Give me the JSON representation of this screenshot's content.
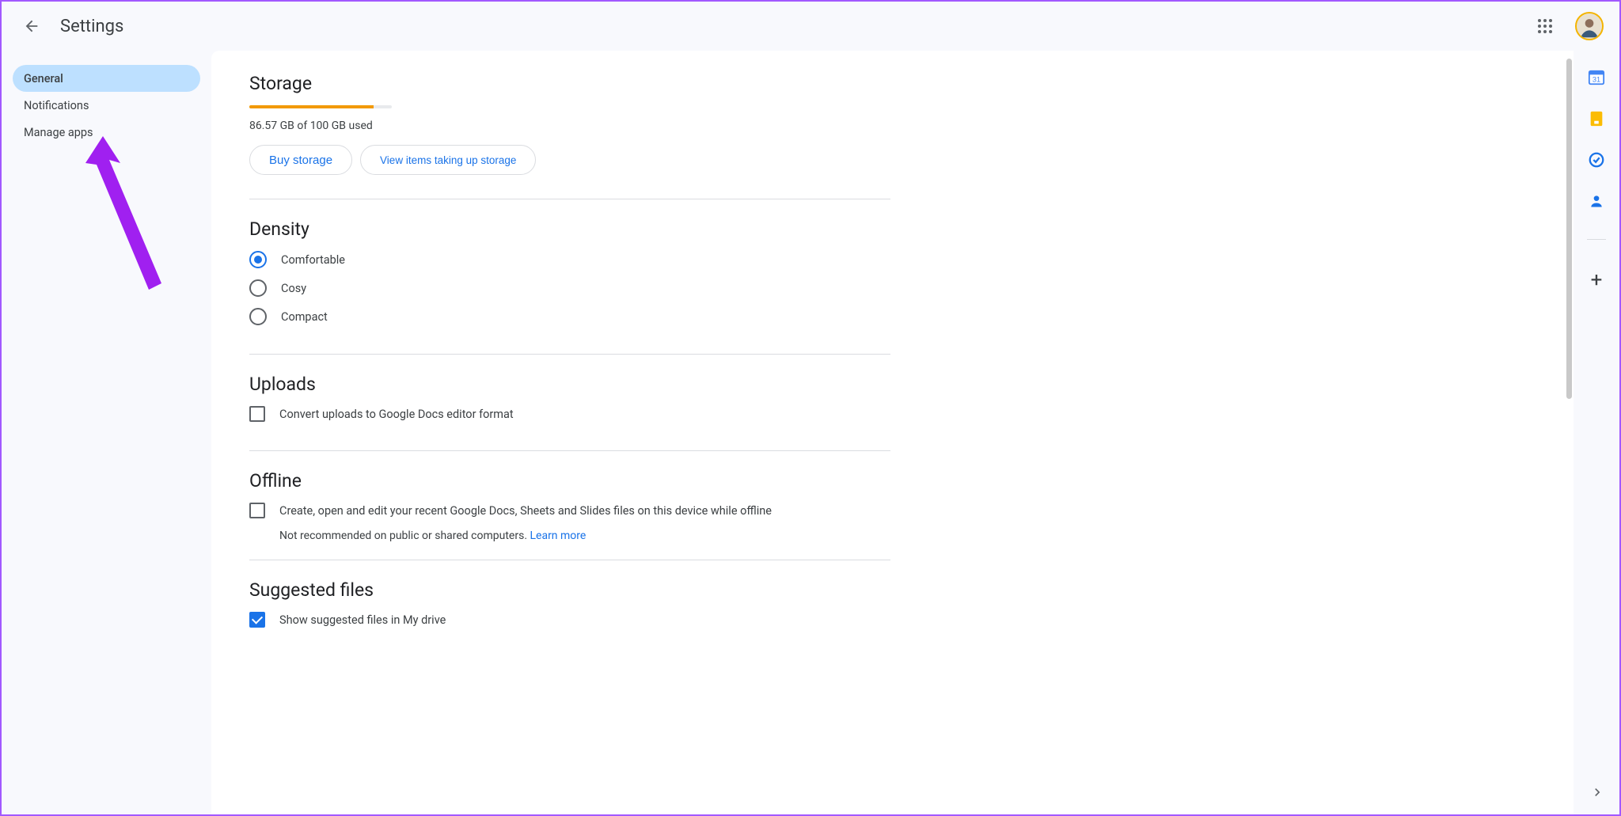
{
  "header": {
    "title": "Settings"
  },
  "nav": {
    "items": [
      {
        "label": "General",
        "active": true
      },
      {
        "label": "Notifications",
        "active": false
      },
      {
        "label": "Manage apps",
        "active": false
      }
    ]
  },
  "storage": {
    "title": "Storage",
    "percent": 87,
    "usage_text": "86.57 GB of 100 GB used",
    "buy_label": "Buy storage",
    "view_label": "View items taking up storage"
  },
  "density": {
    "title": "Density",
    "options": [
      "Comfortable",
      "Cosy",
      "Compact"
    ],
    "selected": 0
  },
  "uploads": {
    "title": "Uploads",
    "convert_label": "Convert uploads to Google Docs editor format",
    "convert_checked": false
  },
  "offline": {
    "title": "Offline",
    "enable_label": "Create, open and edit your recent Google Docs, Sheets and Slides files on this device while offline",
    "enable_checked": false,
    "note_prefix": "Not recommended on public or shared computers. ",
    "learn_more": "Learn more"
  },
  "suggested": {
    "title": "Suggested files",
    "show_label": "Show suggested files in My drive",
    "show_checked": true
  }
}
